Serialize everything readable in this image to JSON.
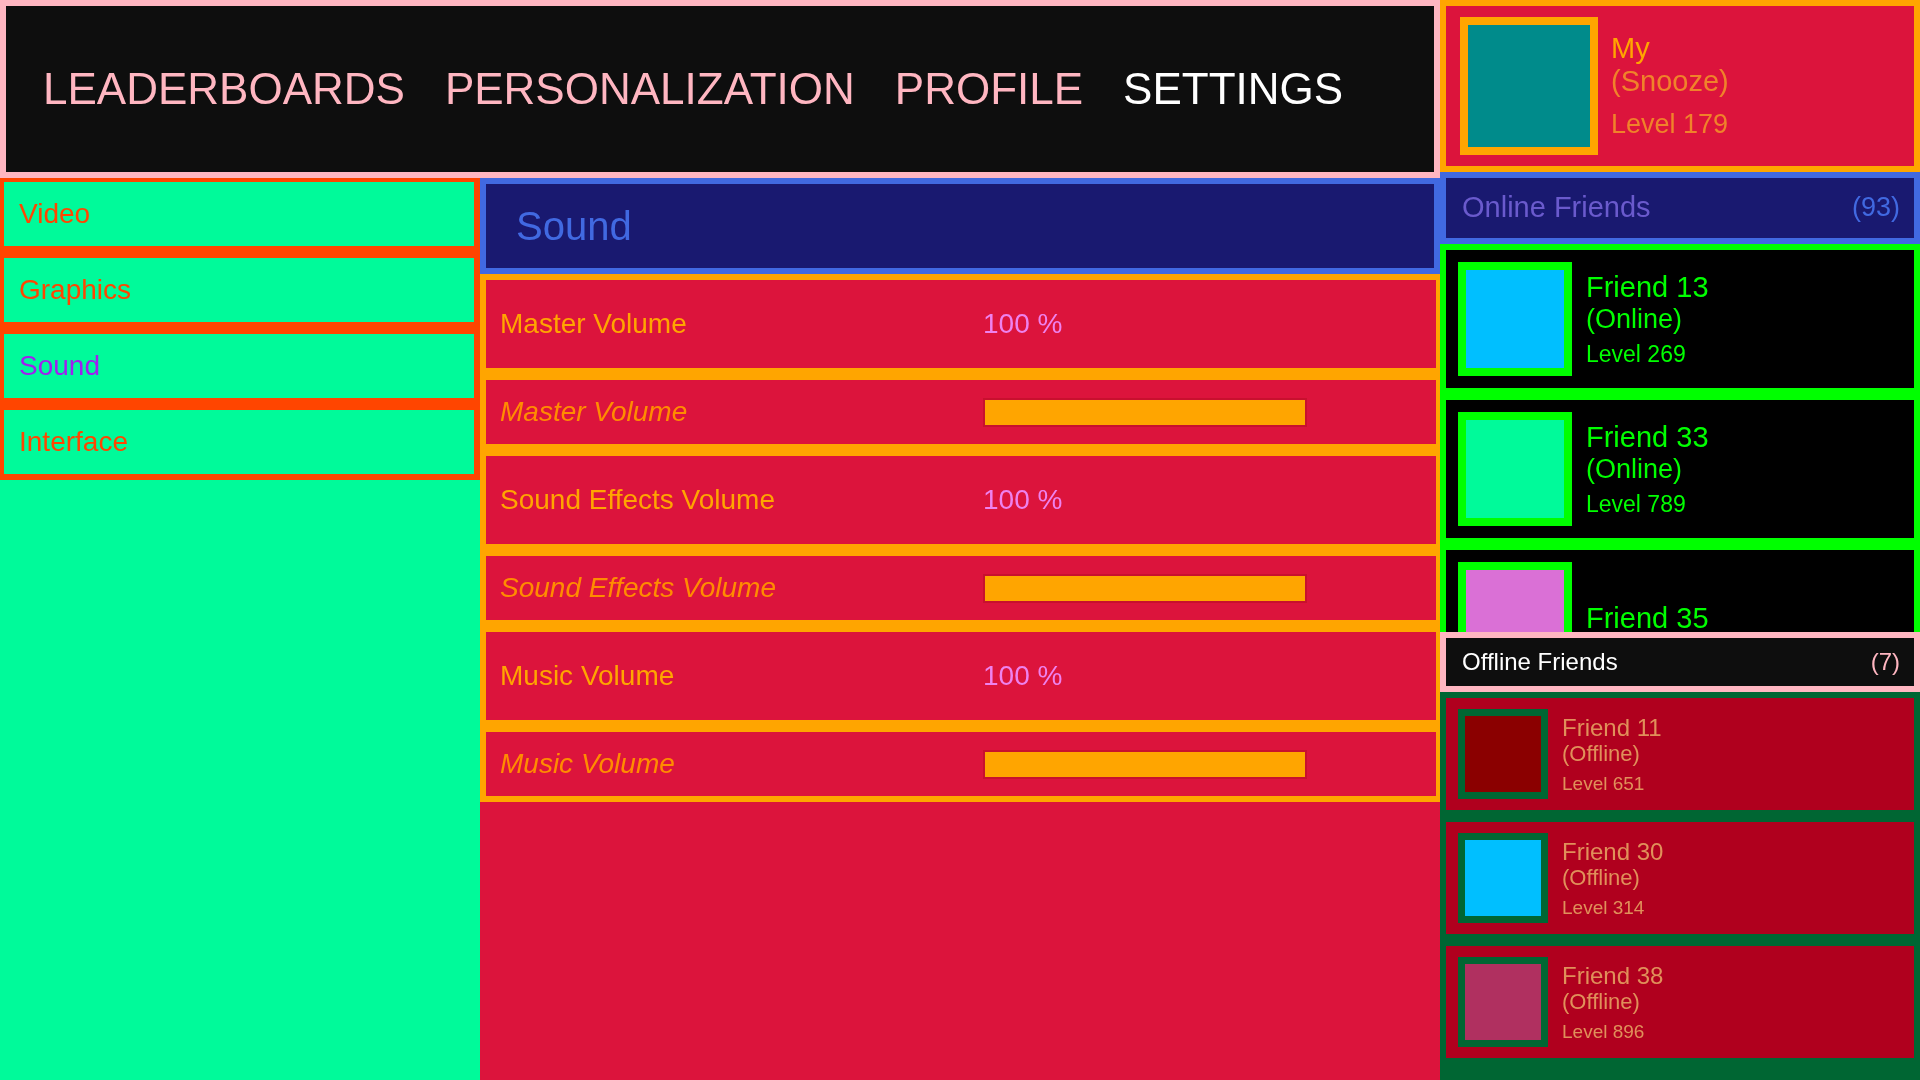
{
  "nav": {
    "tabs": [
      {
        "label": "LEADERBOARDS",
        "selected": false
      },
      {
        "label": "PERSONALIZATION",
        "selected": false
      },
      {
        "label": "PROFILE",
        "selected": false
      },
      {
        "label": "SETTINGS",
        "selected": true
      }
    ]
  },
  "profile": {
    "name": "My",
    "status": "(Snooze)",
    "level": "Level 179",
    "color": "#008b8b"
  },
  "sidebar": {
    "items": [
      {
        "label": "Video",
        "selected": false
      },
      {
        "label": "Graphics",
        "selected": false
      },
      {
        "label": "Sound",
        "selected": true
      },
      {
        "label": "Interface",
        "selected": false
      }
    ]
  },
  "panel": {
    "title": "Sound",
    "settings": [
      {
        "kind": "value",
        "label": "Master Volume",
        "value": "100 %"
      },
      {
        "kind": "slider",
        "label": "Master Volume",
        "level": 1
      },
      {
        "kind": "value",
        "label": "Sound Effects Volume",
        "value": "100 %"
      },
      {
        "kind": "slider",
        "label": "Sound Effects Volume",
        "level": 1
      },
      {
        "kind": "value",
        "label": "Music Volume",
        "value": "100 %"
      },
      {
        "kind": "slider",
        "label": "Music Volume",
        "level": 1
      }
    ]
  },
  "online_friends": {
    "title": "Online Friends",
    "count": "(93)",
    "friends": [
      {
        "name": "Friend 13",
        "status": "(Online)",
        "level": "Level 269",
        "color": "#00bfff"
      },
      {
        "name": "Friend 33",
        "status": "(Online)",
        "level": "Level 789",
        "color": "#00fa9a"
      },
      {
        "name": "Friend 35",
        "color": "#da70d6"
      }
    ]
  },
  "offline_friends": {
    "title": "Offline Friends",
    "count": "(7)",
    "friends": [
      {
        "name": "Friend 11",
        "status": "(Offline)",
        "level": "Level 651",
        "color": "#8b0000"
      },
      {
        "name": "Friend 30",
        "status": "(Offline)",
        "level": "Level 314",
        "color": "#00bfff"
      },
      {
        "name": "Friend 38",
        "status": "(Offline)",
        "level": "Level 896",
        "color": "#b03060"
      }
    ]
  }
}
